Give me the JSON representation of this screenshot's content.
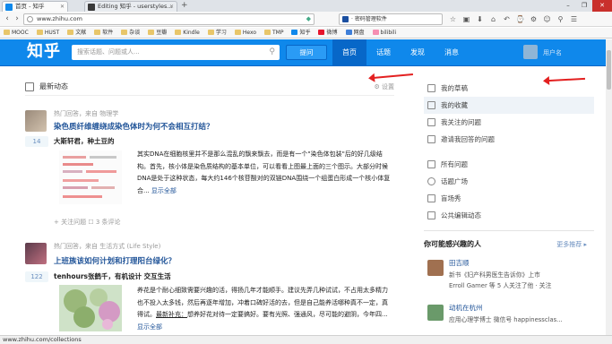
{
  "browser": {
    "tabs": [
      {
        "label": "首页 - 知乎",
        "favicon_color": "#0f88eb",
        "active": true
      },
      {
        "label": "Editing 知乎 - userstyles...",
        "favicon_color": "#3a3a3a",
        "active": false
      }
    ],
    "new_tab": "+",
    "window_controls": [
      "–",
      "❐",
      "✕"
    ],
    "back": "‹",
    "forward": "›",
    "url": "www.zhihu.com",
    "search_text": "· 密码管理软件",
    "toolbar_icons": [
      "☆",
      "▣",
      "⬇",
      "⌂",
      "↶",
      "⌚",
      "⚙",
      "☺",
      "⚲",
      "☰"
    ],
    "bookmarks": [
      "MOOC",
      "HUST",
      "文献",
      "软件",
      "杂谈",
      "豆瓣",
      "Kindle",
      "学习",
      "Hexo",
      "TMP",
      "知乎",
      "微博",
      "网盘",
      "bilibili"
    ]
  },
  "header": {
    "logo": "知乎",
    "search_placeholder": "搜索话题、问题或人...",
    "search_icon": "⚲",
    "ask_button": "提问",
    "nav": [
      "首页",
      "话题",
      "发现",
      "消息"
    ],
    "user_name": "用户名"
  },
  "feed": {
    "header_title": "最新动态",
    "settings_label": "⚙ 设置",
    "items": [
      {
        "meta": "热门回答，来自 物理学",
        "title": "染色质纤维缠绕成染色体时为何不会相互打结？",
        "votes": "14",
        "author": "大斯轩君，种土豆的",
        "excerpt": "其实DNA在细胞核里并不是那么混乱的飘来飘去，而是有一个\"染色体包装\"后的好几级结构。首先，核小体是染色质结构的基本单位，可以看看上图最上面的三个图示。大部分时候DNA是处于这种状态，每大约146个核苷酸对的双链DNA围绕一个组蛋白形成一个核小体复合...",
        "more": "显示全部",
        "actions": "+ 关注问题   ☐ 3 条评论"
      },
      {
        "meta": "热门回答，来自 生活方式 (Life Style)",
        "title": "上班族该如何计划和打理阳台绿化？",
        "votes": "122",
        "author": "tenhours张鹤千，有机设计 交互生活",
        "excerpt_a": "养花是个耐心细致需要兴趣的活，得扬几年才能顺手。建议先弄几种试试，不占用太多精力也不投入太多钱，然后再逐年增加，冲着口碑好活的去，但是自己能养活哪种真不一定，真得试。",
        "excerpt_link": "最新补充：",
        "excerpt_b": "想养好花对待一定要搞好。要有光照、强通风，尽可能的避阴，今年四...",
        "more": "显示全部"
      }
    ]
  },
  "sidebar": {
    "group1": [
      "我的草稿",
      "我的收藏",
      "我关注的问题",
      "邀请我回答的问题"
    ],
    "group2": [
      "所有问题",
      "话题广场",
      "盲场秀",
      "公共编辑动态"
    ],
    "active_index": 1,
    "recommend_title": "你可能感兴趣的人",
    "recommend_more": "更多推荐 ▸",
    "people": [
      {
        "name": "田吉顺",
        "line1": "新书《妇产科男医生告诉你》上市",
        "line2": "Erroll Gamer 等 5 人关注了他 · 关注",
        "color": "#a07050"
      },
      {
        "name": "动机在杭州",
        "line1": "应用心理学博士 微信号 happinessclas...",
        "line2": "",
        "color": "#6a9a6a"
      }
    ]
  },
  "status_url": "www.zhihu.com/collections",
  "colors": {
    "brand": "#0f88eb",
    "link": "#225599",
    "annotation_arrow": "#e32020"
  }
}
